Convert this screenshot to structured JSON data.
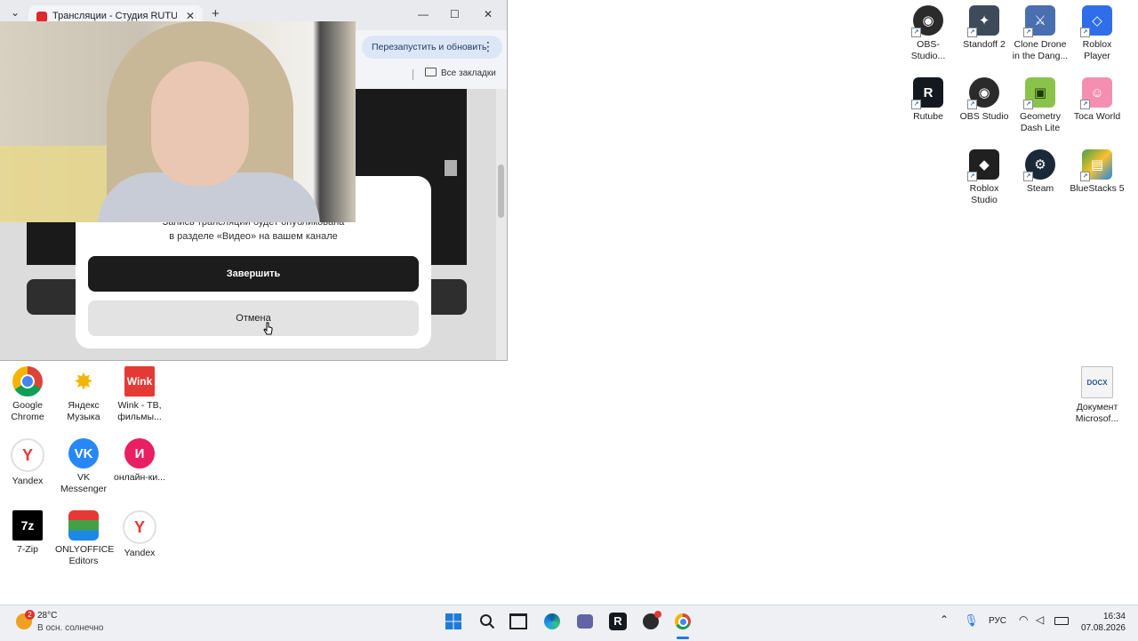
{
  "browser": {
    "tab_title": "Трансляции - Студия RUTUBE",
    "tab_close": "✕",
    "new_tab": "+",
    "dropdown": "⌄",
    "win_minimize": "—",
    "win_maximize": "☐",
    "win_close": "✕",
    "relaunch_label": "Перезапустить и обновить",
    "relaunch_menu": "⋮",
    "bookmarks_label": "Все закладки"
  },
  "dialog": {
    "message_line1": "Запись трансляции будет опубликована",
    "message_line2": "в разделе «Видео» на вашем канале",
    "finish_label": "Завершить",
    "cancel_label": "Отмена"
  },
  "desktop_icons_right": [
    {
      "label": "OBS-Studio...",
      "icon": "obs-icon"
    },
    {
      "label": "Standoff 2",
      "icon": "standoff-icon"
    },
    {
      "label": "Clone Drone in the Dang...",
      "icon": "clone-drone-icon"
    },
    {
      "label": "Roblox Player",
      "icon": "roblox-player-icon"
    },
    {
      "label": "Rutube",
      "icon": "rutube-icon"
    },
    {
      "label": "OBS Studio",
      "icon": "obs-icon"
    },
    {
      "label": "Geometry Dash Lite",
      "icon": "geometry-dash-icon"
    },
    {
      "label": "Toca World",
      "icon": "toca-world-icon"
    },
    {
      "label": "Roblox Studio",
      "icon": "roblox-studio-icon"
    },
    {
      "label": "Steam",
      "icon": "steam-icon"
    },
    {
      "label": "BlueStacks 5",
      "icon": "bluestacks-icon"
    },
    {
      "label": "Документ Microsof...",
      "icon": "docx-icon"
    }
  ],
  "desktop_icons_left": [
    {
      "label": "Google Chrome",
      "icon": "chrome-icon"
    },
    {
      "label": "Яндекс Музыка",
      "icon": "yandex-music-icon"
    },
    {
      "label": "Wink - ТВ, фильмы...",
      "icon": "wink-icon",
      "glyph": "Wink"
    },
    {
      "label": "Yandex",
      "icon": "yandex-icon"
    },
    {
      "label": "VK Messenger",
      "icon": "vk-icon"
    },
    {
      "label": "онлайн-ки...",
      "icon": "online-kino-icon"
    },
    {
      "label": "7-Zip",
      "icon": "7zip-icon",
      "glyph": "7z"
    },
    {
      "label": "ONLYOFFICE Editors",
      "icon": "onlyoffice-icon"
    },
    {
      "label": "Yandex",
      "icon": "yandex-icon"
    }
  ],
  "taskbar": {
    "weather_badge": "2",
    "temperature": "28°C",
    "weather_desc": "В осн. солнечно",
    "lang": "РУС",
    "time": "16:34",
    "date": "07.08.2026"
  },
  "colors": {
    "accent_red": "#e2262f",
    "dialog_dark_button": "#1c1c1c",
    "taskbar_bg": "#eef0f4"
  }
}
